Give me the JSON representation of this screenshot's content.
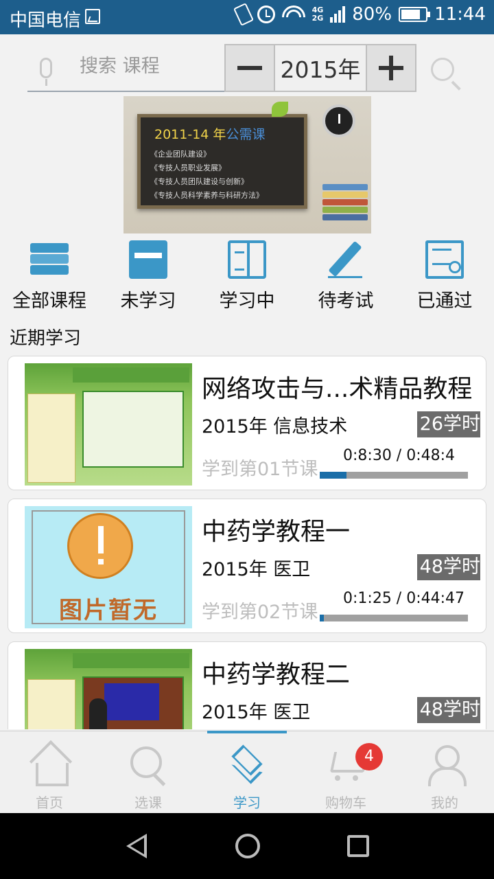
{
  "status_bar": {
    "carrier": "中国电信",
    "network_top": "4G",
    "network_bottom": "2G",
    "battery": "80%",
    "time": "11:44"
  },
  "search": {
    "placeholder": "搜索 课程",
    "icon": "search-icon",
    "mic_icon": "mic-icon"
  },
  "year_stepper": {
    "value": "2015年",
    "minus_icon": "minus-icon",
    "plus_icon": "plus-icon"
  },
  "banner": {
    "title_prefix": "2011-14 年",
    "title_suffix": "公需课",
    "lines": [
      "《企业团队建设》",
      "《专技人员职业发展》",
      "《专技人员团队建设与创新》",
      "《专技人员科学素养与科研方法》"
    ]
  },
  "categories": [
    {
      "label": "全部课程",
      "icon": "stack-icon"
    },
    {
      "label": "未学习",
      "icon": "book-icon"
    },
    {
      "label": "学习中",
      "icon": "open-book-icon"
    },
    {
      "label": "待考试",
      "icon": "pencil-icon"
    },
    {
      "label": "已通过",
      "icon": "certificate-icon"
    }
  ],
  "recent": {
    "title": "近期学习",
    "courses": [
      {
        "title": "网络攻击与...术精品教程",
        "meta": "2015年 信息技术",
        "hours": "26学时",
        "progress_label": "学到第01节课",
        "time": "0:8:30 / 0:48:4",
        "progress": 0.18,
        "thumb": "slide"
      },
      {
        "title": "中药学教程一",
        "meta": "2015年 医卫",
        "hours": "48学时",
        "progress_label": "学到第02节课",
        "time": "0:1:25 / 0:44:47",
        "progress": 0.03,
        "thumb": "none",
        "thumb_text": "图片暂无"
      },
      {
        "title": "中药学教程二",
        "meta": "2015年 医卫",
        "hours": "48学时",
        "thumb": "video"
      }
    ]
  },
  "bottom_nav": [
    {
      "label": "首页",
      "icon": "home-icon",
      "active": false
    },
    {
      "label": "选课",
      "icon": "search-icon",
      "active": false
    },
    {
      "label": "学习",
      "icon": "layers-icon",
      "active": true
    },
    {
      "label": "购物车",
      "icon": "cart-icon",
      "active": false,
      "badge": "4"
    },
    {
      "label": "我的",
      "icon": "user-icon",
      "active": false
    }
  ],
  "colors": {
    "status_bar": "#1d5e8c",
    "accent": "#3b97c7",
    "badge": "#e53935",
    "hours_badge": "#6b6b6b",
    "progress_fill": "#1a6ea8"
  }
}
